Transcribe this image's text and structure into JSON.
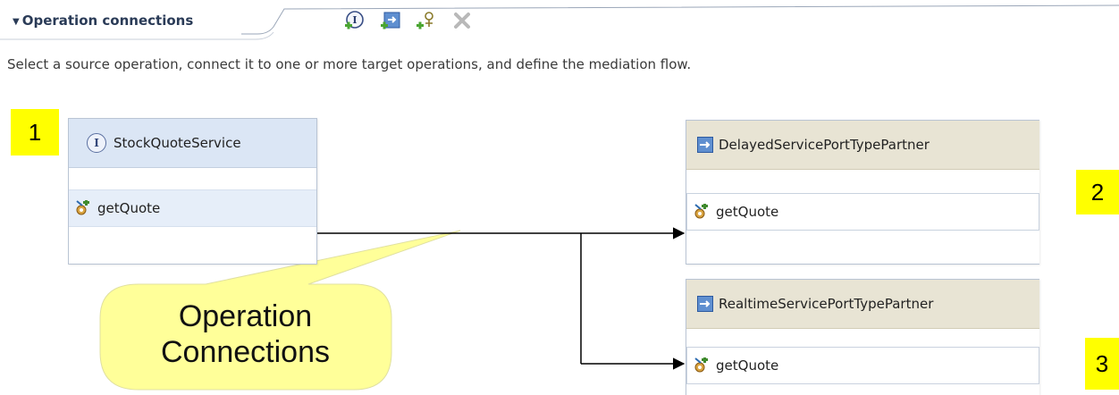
{
  "section": {
    "title": "Operation connections",
    "description": "Select a source operation, connect it to one or more target operations, and define the mediation flow.",
    "toolbar": [
      {
        "name": "add-interface-icon"
      },
      {
        "name": "add-reference-icon"
      },
      {
        "name": "add-operation-connection-icon"
      },
      {
        "name": "delete-icon"
      }
    ]
  },
  "badges": [
    "1",
    "2",
    "3"
  ],
  "source": {
    "interface_name": "StockQuoteService",
    "interface_icon_glyph": "I",
    "operation": "getQuote"
  },
  "targets": [
    {
      "reference_name": "DelayedServicePortTypePartner",
      "operation": "getQuote"
    },
    {
      "reference_name": "RealtimeServicePortTypePartner",
      "operation": "getQuote"
    }
  ],
  "callout": {
    "line1": "Operation",
    "line2": "Connections",
    "fill": "#ffff99"
  },
  "colors": {
    "badge": "#ffff00",
    "source_header": "#dbe6f5",
    "target_header": "#e8e4d4"
  }
}
